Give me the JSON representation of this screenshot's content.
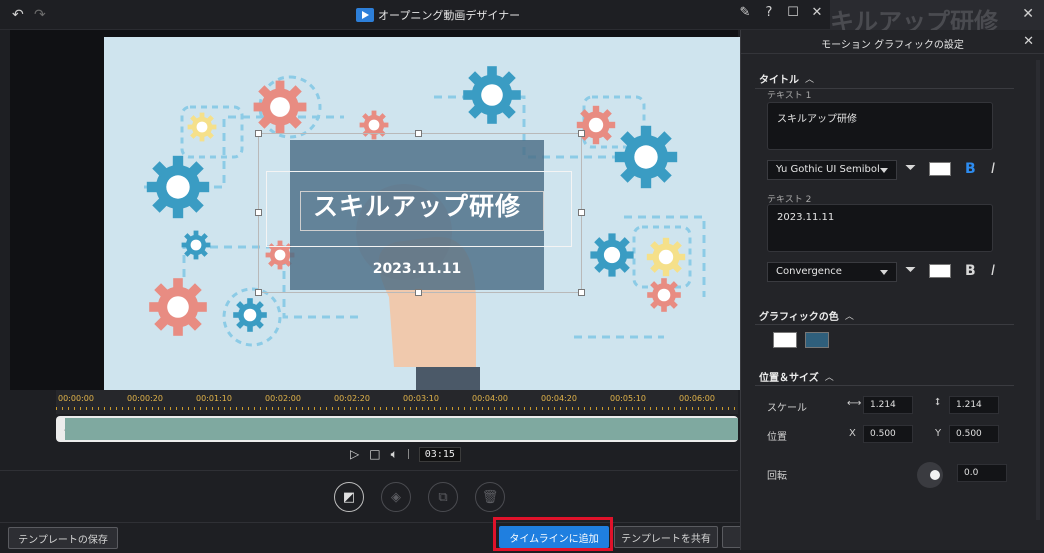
{
  "window": {
    "title": "オープニング動画デザイナー",
    "undo_icon": "undo-icon",
    "redo_icon": "redo-icon",
    "background_text": "キルアップ研修"
  },
  "preview": {
    "title_text": "スキルアップ研修",
    "date_text": "2023.11.11"
  },
  "timeline": {
    "ticks": [
      "00:00:00",
      "00:00:20",
      "00:01:10",
      "00:02:00",
      "00:02:20",
      "00:03:10",
      "00:04:00",
      "00:04:20",
      "00:05:10",
      "00:06:00"
    ],
    "timecode": "03:15"
  },
  "footer": {
    "save_template": "テンプレートの保存",
    "add_to_timeline": "タイムラインに追加",
    "share_template": "テンプレートを共有"
  },
  "panel": {
    "title": "モーション グラフィックの設定",
    "title_section": "タイトル",
    "text1_label": "テキスト 1",
    "text1_value": "スキルアップ研修",
    "text1_font": "Yu Gothic UI Semibol",
    "text2_label": "テキスト 2",
    "text2_value": "2023.11.11",
    "text2_font": "Convergence",
    "bold_label": "B",
    "italic_label": "I",
    "graphic_color_section": "グラフィックの色",
    "graphic_colors": [
      "#ffffff",
      "#2f5f7c"
    ],
    "pos_size_section": "位置＆サイズ",
    "scale_label": "スケール",
    "scale_w": "1.214",
    "scale_h": "1.214",
    "position_label": "位置",
    "x_label": "X",
    "y_label": "Y",
    "pos_x": "0.500",
    "pos_y": "0.500",
    "rotation_label": "回転",
    "rotation_value": "0.0"
  },
  "colors": {
    "accent": "#1f7fe0",
    "highlight": "#e0122a",
    "bold_active": "#2d8cf0"
  }
}
